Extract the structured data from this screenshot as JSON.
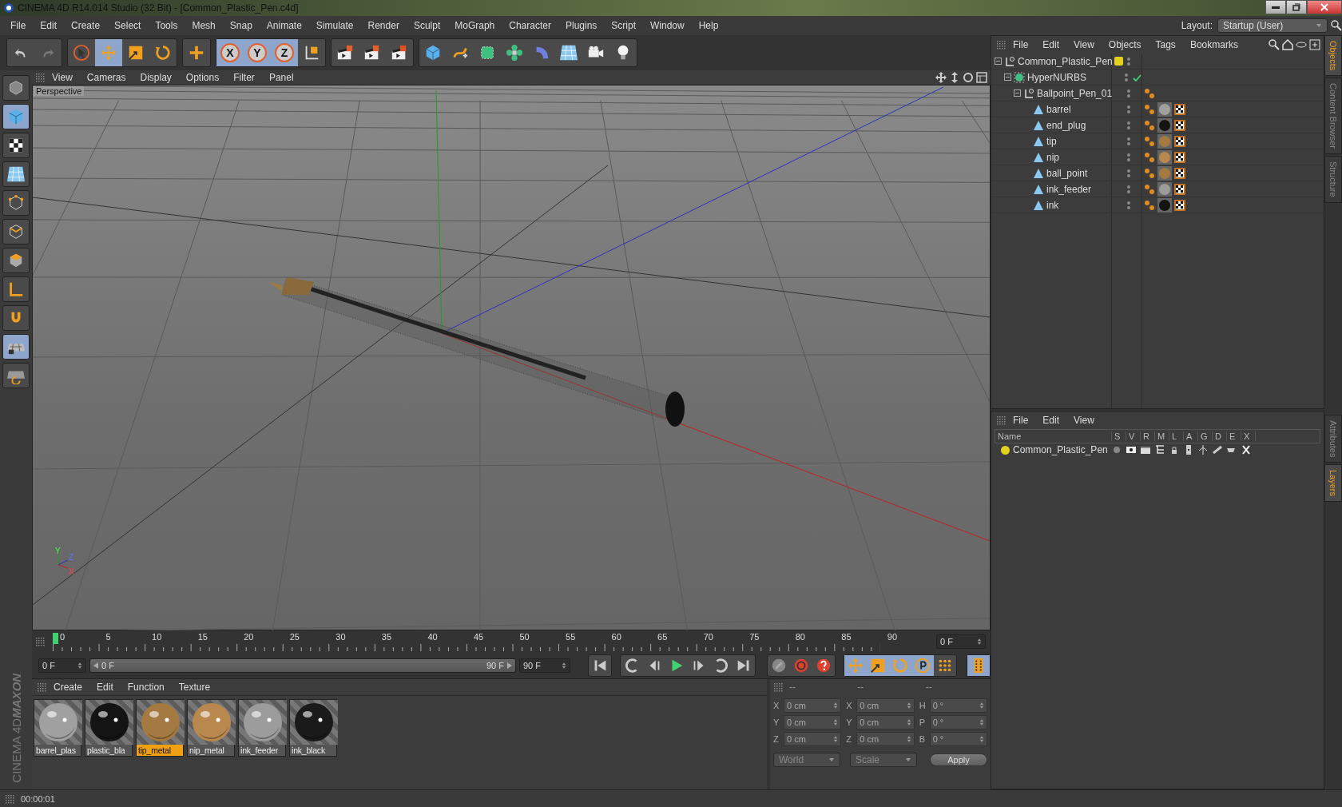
{
  "window": {
    "title": "CINEMA 4D R14.014 Studio (32 Bit) - [Common_Plastic_Pen.c4d]"
  },
  "menu": [
    "File",
    "Edit",
    "Create",
    "Select",
    "Tools",
    "Mesh",
    "Snap",
    "Animate",
    "Simulate",
    "Render",
    "Sculpt",
    "MoGraph",
    "Character",
    "Plugins",
    "Script",
    "Window",
    "Help"
  ],
  "layout": {
    "label": "Layout:",
    "value": "Startup (User)"
  },
  "toolbar": [
    {
      "items": [
        {
          "kind": "undo",
          "selected": false
        },
        {
          "kind": "redo",
          "selected": false
        }
      ]
    },
    {
      "items": [
        {
          "kind": "select",
          "selected": false
        },
        {
          "kind": "move",
          "selected": true
        },
        {
          "kind": "scale",
          "selected": false
        },
        {
          "kind": "rotate",
          "selected": false
        }
      ]
    },
    {
      "items": [
        {
          "kind": "add",
          "selected": false
        }
      ]
    },
    {
      "items": [
        {
          "kind": "axis",
          "label": "X",
          "selected": true
        },
        {
          "kind": "axis",
          "label": "Y",
          "selected": true
        },
        {
          "kind": "axis",
          "label": "Z",
          "selected": true
        },
        {
          "kind": "coord",
          "selected": false
        }
      ]
    },
    {
      "items": [
        {
          "kind": "render-view",
          "selected": false
        },
        {
          "kind": "render-picture",
          "selected": false
        },
        {
          "kind": "render-settings",
          "selected": false
        }
      ]
    },
    {
      "items": [
        {
          "kind": "cube",
          "selected": false
        },
        {
          "kind": "spline",
          "selected": false
        },
        {
          "kind": "nurbs",
          "selected": false
        },
        {
          "kind": "array",
          "selected": false
        },
        {
          "kind": "deformer",
          "selected": false
        },
        {
          "kind": "floor",
          "selected": false
        },
        {
          "kind": "camera",
          "selected": false
        },
        {
          "kind": "light",
          "selected": false
        }
      ]
    }
  ],
  "left_tools": [
    {
      "kind": "view-cube",
      "selected": false
    },
    {
      "kind": "model",
      "selected": true
    },
    {
      "kind": "texture",
      "selected": false
    },
    {
      "kind": "workplane",
      "selected": false
    },
    {
      "kind": "points",
      "selected": false
    },
    {
      "kind": "edges",
      "selected": false
    },
    {
      "kind": "polygons",
      "selected": false
    },
    {
      "kind": "axis-corner",
      "selected": false
    },
    {
      "kind": "magnet",
      "selected": false
    },
    {
      "kind": "grid-lock",
      "selected": true
    },
    {
      "kind": "grid-snap",
      "selected": false
    }
  ],
  "logo": {
    "brand": "MAXON",
    "product": "CINEMA 4D"
  },
  "viewport": {
    "menu": [
      "View",
      "Cameras",
      "Display",
      "Options",
      "Filter",
      "Panel"
    ],
    "label": "Perspective",
    "gizmo": [
      "Y",
      "Z",
      "X"
    ]
  },
  "timeline": {
    "ticks": [
      "0",
      "5",
      "10",
      "15",
      "20",
      "25",
      "30",
      "35",
      "40",
      "45",
      "50",
      "55",
      "60",
      "65",
      "70",
      "75",
      "80",
      "85",
      "90"
    ],
    "current": "0 F",
    "start": "0 F",
    "range_start": "0 F",
    "range_end": "90 F",
    "end": "90 F",
    "level": 1
  },
  "transport": [
    {
      "kind": "first",
      "selected": false
    },
    {
      "kind": "prev-key",
      "selected": false
    },
    {
      "kind": "prev-frame",
      "selected": false
    },
    {
      "kind": "play",
      "selected": false
    },
    {
      "kind": "next-frame",
      "selected": false
    },
    {
      "kind": "next-key",
      "selected": false
    },
    {
      "kind": "last",
      "selected": false
    },
    {
      "kind": "keys",
      "selected": false
    },
    {
      "kind": "record",
      "selected": false
    },
    {
      "kind": "help",
      "selected": false
    },
    {
      "kind": "key-pos",
      "selected": true
    },
    {
      "kind": "key-scale",
      "selected": true
    },
    {
      "kind": "key-rot",
      "selected": true
    },
    {
      "kind": "key-param",
      "selected": true
    },
    {
      "kind": "key-point",
      "selected": false
    },
    {
      "kind": "film",
      "selected": true
    }
  ],
  "materials": {
    "menu": [
      "Create",
      "Edit",
      "Function",
      "Texture"
    ],
    "items": [
      {
        "name": "barrel_plas",
        "color": "#a0a0a0",
        "selected": false
      },
      {
        "name": "plastic_bla",
        "color": "#141414",
        "selected": false
      },
      {
        "name": "tip_metal",
        "color": "#a57a42",
        "selected": true
      },
      {
        "name": "nip_metal",
        "color": "#b8884e",
        "selected": false
      },
      {
        "name": "ink_feeder",
        "color": "#9c9c9c",
        "selected": false
      },
      {
        "name": "ink_black",
        "color": "#1a1a1a",
        "selected": false
      }
    ]
  },
  "coordinates": {
    "headers": [
      "--",
      "--",
      "--"
    ],
    "rows": [
      [
        {
          "axis": "X",
          "value": "0 cm"
        },
        {
          "axis": "X",
          "value": "0 cm"
        },
        {
          "axis": "H",
          "value": "0 °"
        }
      ],
      [
        {
          "axis": "Y",
          "value": "0 cm"
        },
        {
          "axis": "Y",
          "value": "0 cm"
        },
        {
          "axis": "P",
          "value": "0 °"
        }
      ],
      [
        {
          "axis": "Z",
          "value": "0 cm"
        },
        {
          "axis": "Z",
          "value": "0 cm"
        },
        {
          "axis": "B",
          "value": "0 °"
        }
      ]
    ],
    "space": "World",
    "mode": "Scale",
    "apply": "Apply"
  },
  "objects": {
    "menu": [
      "File",
      "Edit",
      "View",
      "Objects",
      "Tags",
      "Bookmarks"
    ],
    "tree": [
      {
        "name": "Common_Plastic_Pen",
        "kind": "null",
        "expanded": true,
        "enabled": false,
        "color": "#e2d21e",
        "children": [
          {
            "name": "HyperNURBS",
            "kind": "nurbs",
            "expanded": true,
            "enabled": true,
            "children": [
              {
                "name": "Ballpoint_Pen_01",
                "kind": "null",
                "expanded": true,
                "enabled": false,
                "tags": [
                  {
                    "kind": "phong"
                  }
                ],
                "children": [
                  {
                    "name": "barrel",
                    "kind": "polygon",
                    "enabled": false,
                    "tags": [
                      {
                        "kind": "phong"
                      },
                      {
                        "kind": "material",
                        "color": "#a0a0a0"
                      },
                      {
                        "kind": "uvw"
                      }
                    ]
                  },
                  {
                    "name": "end_plug",
                    "kind": "polygon",
                    "enabled": false,
                    "tags": [
                      {
                        "kind": "phong"
                      },
                      {
                        "kind": "material",
                        "color": "#141414"
                      },
                      {
                        "kind": "uvw"
                      }
                    ]
                  },
                  {
                    "name": "tip",
                    "kind": "polygon",
                    "enabled": false,
                    "tags": [
                      {
                        "kind": "phong"
                      },
                      {
                        "kind": "material",
                        "color": "#a57a42"
                      },
                      {
                        "kind": "uvw"
                      }
                    ]
                  },
                  {
                    "name": "nip",
                    "kind": "polygon",
                    "enabled": false,
                    "tags": [
                      {
                        "kind": "phong"
                      },
                      {
                        "kind": "material",
                        "color": "#b8884e"
                      },
                      {
                        "kind": "uvw"
                      }
                    ]
                  },
                  {
                    "name": "ball_point",
                    "kind": "polygon",
                    "enabled": false,
                    "tags": [
                      {
                        "kind": "phong"
                      },
                      {
                        "kind": "material",
                        "color": "#a57a42"
                      },
                      {
                        "kind": "uvw"
                      }
                    ]
                  },
                  {
                    "name": "ink_feeder",
                    "kind": "polygon",
                    "enabled": false,
                    "tags": [
                      {
                        "kind": "phong"
                      },
                      {
                        "kind": "material",
                        "color": "#9c9c9c"
                      },
                      {
                        "kind": "uvw"
                      }
                    ]
                  },
                  {
                    "name": "ink",
                    "kind": "polygon",
                    "enabled": false,
                    "tags": [
                      {
                        "kind": "phong"
                      },
                      {
                        "kind": "material",
                        "color": "#141414"
                      },
                      {
                        "kind": "uvw"
                      }
                    ]
                  }
                ]
              }
            ]
          }
        ]
      }
    ]
  },
  "layers": {
    "menu": [
      "File",
      "Edit",
      "View"
    ],
    "columns": [
      "Name",
      "S",
      "V",
      "R",
      "M",
      "L",
      "A",
      "G",
      "D",
      "E",
      "X"
    ],
    "rows": [
      {
        "name": "Common_Plastic_Pen",
        "color": "#e2d21e"
      }
    ]
  },
  "side_tabs_top": [
    {
      "label": "Objects",
      "selected": true
    },
    {
      "label": "Content Browser",
      "selected": false
    },
    {
      "label": "Structure",
      "selected": false
    }
  ],
  "side_tabs_bottom": [
    {
      "label": "Attributes",
      "selected": false
    },
    {
      "label": "Layers",
      "selected": true
    }
  ],
  "status": {
    "time": "00:00:01"
  }
}
